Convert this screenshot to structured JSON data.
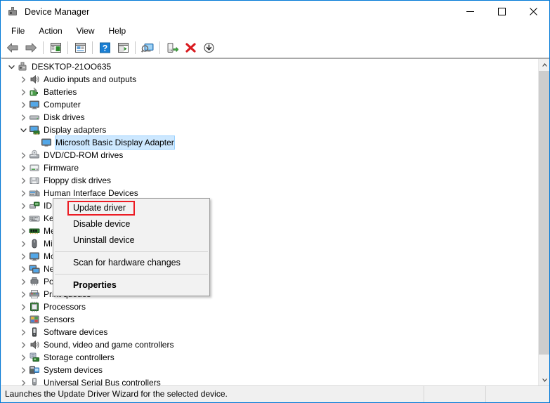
{
  "window": {
    "title": "Device Manager",
    "app_icon": "device-manager-icon",
    "minimize": "—",
    "maximize": "□",
    "close": "✕"
  },
  "menubar": {
    "items": [
      {
        "label": "File"
      },
      {
        "label": "Action"
      },
      {
        "label": "View"
      },
      {
        "label": "Help"
      }
    ]
  },
  "toolbar": {
    "buttons": [
      {
        "name": "back-icon",
        "tooltip": "Back"
      },
      {
        "name": "forward-icon",
        "tooltip": "Forward"
      },
      {
        "name": "show-hide-console-tree-icon",
        "tooltip": "Show/Hide Console Tree"
      },
      {
        "name": "properties-icon",
        "tooltip": "Properties"
      },
      {
        "name": "help-icon",
        "tooltip": "Help"
      },
      {
        "name": "show-hide-action-pane-icon",
        "tooltip": "Show/Hide Action Pane"
      },
      {
        "name": "scan-for-hardware-changes-icon",
        "tooltip": "Scan for hardware changes"
      },
      {
        "name": "update-driver-icon",
        "tooltip": "Update driver"
      },
      {
        "name": "uninstall-device-icon",
        "tooltip": "Uninstall device"
      },
      {
        "name": "disable-device-icon",
        "tooltip": "Disable device"
      }
    ]
  },
  "tree": {
    "root": {
      "label": "DESKTOP-21OO635",
      "icon": "computer-root-icon",
      "expanded": true
    },
    "items": [
      {
        "label": "Audio inputs and outputs",
        "icon": "speaker-icon",
        "expanded": false,
        "level": 1
      },
      {
        "label": "Batteries",
        "icon": "battery-icon",
        "expanded": false,
        "level": 1
      },
      {
        "label": "Computer",
        "icon": "monitor-icon",
        "expanded": false,
        "level": 1
      },
      {
        "label": "Disk drives",
        "icon": "disk-drive-icon",
        "expanded": false,
        "level": 1
      },
      {
        "label": "Display adapters",
        "icon": "display-adapter-icon",
        "expanded": true,
        "level": 1
      },
      {
        "label": "Microsoft Basic Display Adapter",
        "icon": "display-device-icon",
        "expanded": null,
        "level": 2,
        "selected": true
      },
      {
        "label": "DVD/CD-ROM drives",
        "icon": "dvd-drive-icon",
        "expanded": false,
        "level": 1
      },
      {
        "label": "Firmware",
        "icon": "firmware-icon",
        "expanded": false,
        "level": 1
      },
      {
        "label": "Floppy disk drives",
        "icon": "floppy-controller-icon",
        "expanded": false,
        "level": 1
      },
      {
        "label": "Human Interface Devices",
        "icon": "hid-icon",
        "expanded": false,
        "level": 1
      },
      {
        "label": "IDE ATA/ATAPI controllers",
        "icon": "ide-controller-icon",
        "expanded": false,
        "level": 1
      },
      {
        "label": "Keyboards",
        "icon": "keyboard-icon",
        "expanded": false,
        "level": 1
      },
      {
        "label": "Memory devices",
        "icon": "memory-icon",
        "expanded": false,
        "level": 1
      },
      {
        "label": "Mice and other pointing devices",
        "icon": "mouse-icon",
        "expanded": false,
        "level": 1
      },
      {
        "label": "Monitors",
        "icon": "monitor-icon",
        "expanded": false,
        "level": 1
      },
      {
        "label": "Network adapters",
        "icon": "network-adapter-icon",
        "expanded": false,
        "level": 1
      },
      {
        "label": "Ports (COM & LPT)",
        "icon": "port-icon",
        "expanded": false,
        "level": 1
      },
      {
        "label": "Print queues",
        "icon": "printer-icon",
        "expanded": false,
        "level": 1
      },
      {
        "label": "Processors",
        "icon": "processor-icon",
        "expanded": false,
        "level": 1
      },
      {
        "label": "Sensors",
        "icon": "sensor-icon",
        "expanded": false,
        "level": 1
      },
      {
        "label": "Software devices",
        "icon": "software-device-icon",
        "expanded": false,
        "level": 1
      },
      {
        "label": "Sound, video and game controllers",
        "icon": "speaker-icon",
        "expanded": false,
        "level": 1
      },
      {
        "label": "Storage controllers",
        "icon": "storage-controller-icon",
        "expanded": false,
        "level": 1
      },
      {
        "label": "System devices",
        "icon": "system-device-icon",
        "expanded": false,
        "level": 1
      },
      {
        "label": "Universal Serial Bus controllers",
        "icon": "usb-controller-icon",
        "expanded": false,
        "level": 1
      }
    ]
  },
  "context_menu": {
    "items": [
      {
        "label": "Update driver",
        "bold": false,
        "highlighted": true
      },
      {
        "label": "Disable device",
        "bold": false,
        "highlighted": false
      },
      {
        "label": "Uninstall device",
        "bold": false,
        "highlighted": false
      },
      {
        "separator": true
      },
      {
        "label": "Scan for hardware changes",
        "bold": false,
        "highlighted": false
      },
      {
        "separator": true
      },
      {
        "label": "Properties",
        "bold": true,
        "highlighted": false
      }
    ],
    "highlight_color": "#ec1c24"
  },
  "statusbar": {
    "text": "Launches the Update Driver Wizard for the selected device."
  },
  "colors": {
    "window_border": "#0078d7",
    "selection": "#cde8ff",
    "highlight_red": "#ec1c24",
    "toolbar_bg": "#ffffff",
    "status_bg": "#f0f0f0"
  }
}
